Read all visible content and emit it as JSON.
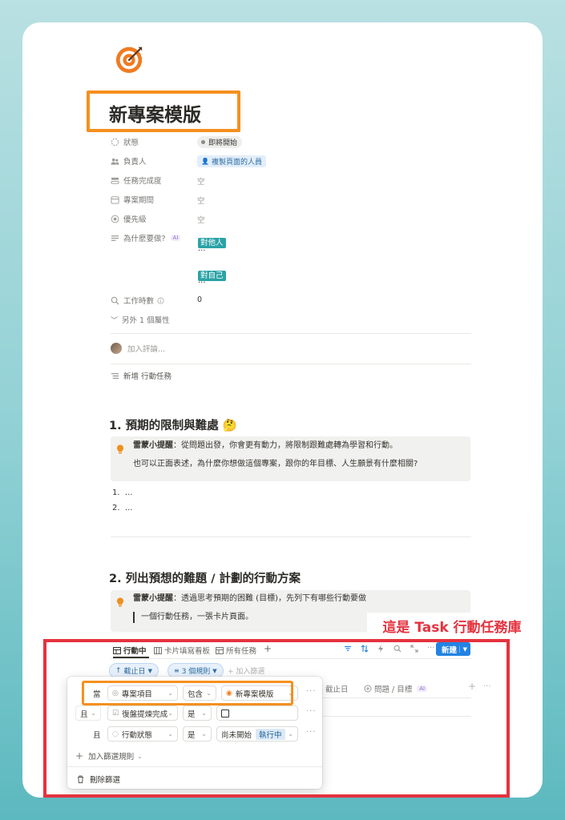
{
  "page": {
    "icon": "target-icon",
    "title": "新專案模版"
  },
  "properties": [
    {
      "label": "狀態",
      "icon": "status-icon"
    },
    {
      "label": "負責人",
      "icon": "people-icon"
    },
    {
      "label": "任務完成度",
      "icon": "progress-icon"
    },
    {
      "label": "專案期間",
      "icon": "calendar-icon"
    },
    {
      "label": "優先級",
      "icon": "priority-icon"
    },
    {
      "label": "為什麼要做?",
      "icon": "text-icon",
      "badge": "AI"
    },
    {
      "label": "工作時數",
      "icon": "search-icon",
      "info_icon": "info-icon"
    }
  ],
  "values": {
    "status": "即將開始",
    "owner": "複製頁面的人員",
    "completion": "空",
    "period": "空",
    "priority": "空",
    "why_tag1": "對他人",
    "why_ellipsis1": "...",
    "why_tag2": "對自己",
    "why_ellipsis2": "...",
    "hours": "0"
  },
  "more_properties": "另外 1 個屬性",
  "comment_placeholder": "加入評論...",
  "add_task": "新增 行動任務",
  "sections": [
    {
      "heading": "1. 預期的限制與難處",
      "heading_emoji": "🤔",
      "callout_bold": "雷蒙小提醒",
      "callout_line1": "：從問題出發，你會更有動力，將限制跟難處轉為學習和行動。",
      "callout_line2": "也可以正面表述，為什麼你想做這個專案，跟你的年目標、人生願景有什麼相關?",
      "list": [
        "1.",
        "...",
        "2.",
        "..."
      ]
    },
    {
      "heading": "2. 列出預想的難題 / 計劃的行動方案",
      "callout_bold": "雷蒙小提醒",
      "callout_line1": "：透過思考預期的困難 (目標)，先列下有哪些行動要做",
      "callout_line2": "一個行動任務，一張卡片頁面。"
    }
  ],
  "annotation": "這是 Task 行動任務庫",
  "database": {
    "tabs": [
      "行動中",
      "卡片填寫看板",
      "所有任務"
    ],
    "add_view": "+",
    "new_button": "新建",
    "sort_pill": "截止日",
    "rules_pill": "3 個規則",
    "add_filter": "加入篩選",
    "columns": [
      "截止日",
      "問題 / 目標"
    ],
    "columns_badge": "AI",
    "col_add": "+",
    "col_more": "···"
  },
  "filter_popup": {
    "rows": [
      {
        "conj": "當",
        "property": "專案項目",
        "op": "包含",
        "value": "新專案模版"
      },
      {
        "conj": "且",
        "property": "復盤提煉完成",
        "op": "是",
        "value": ""
      },
      {
        "conj": "且",
        "property": "行動狀態",
        "op": "是",
        "value": "尚未開始",
        "value2": "執行中"
      }
    ],
    "more": "···",
    "add_rule": "加入篩選規則",
    "delete": "刪除篩選"
  },
  "colors": {
    "accent_orange": "#f5901e",
    "annotation_red": "#e5323f",
    "teal_tag": "#2ba3a6",
    "primary_blue": "#2383e2"
  }
}
